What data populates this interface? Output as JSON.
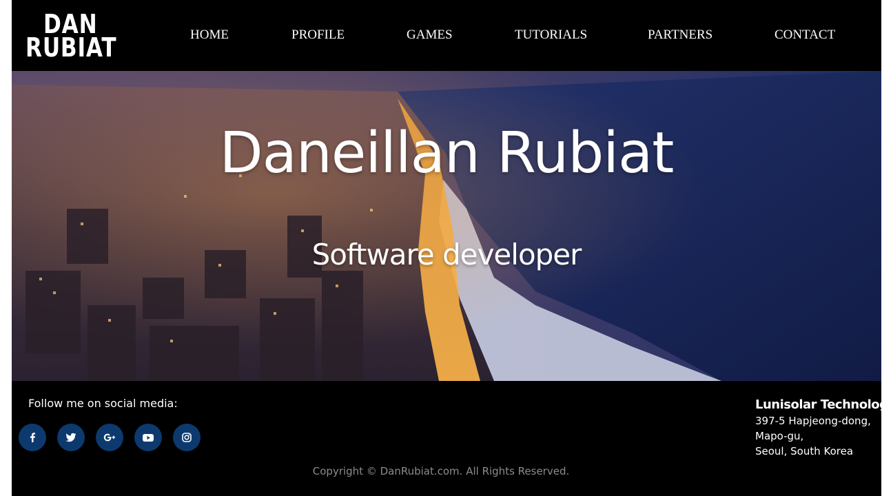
{
  "header": {
    "logo": {
      "line1": "DAN",
      "line2": "RUBIAT"
    },
    "nav": [
      {
        "label": "HOME"
      },
      {
        "label": "PROFILE"
      },
      {
        "label": "GAMES"
      },
      {
        "label": "TUTORIALS"
      },
      {
        "label": "PARTNERS"
      },
      {
        "label": "CONTACT"
      }
    ]
  },
  "hero": {
    "title": "Daneillan Rubiat",
    "subtitle": "Software developer"
  },
  "footer": {
    "follow_label": "Follow me on social media:",
    "social": [
      {
        "icon": "facebook-icon"
      },
      {
        "icon": "twitter-icon"
      },
      {
        "icon": "google-plus-icon"
      },
      {
        "icon": "youtube-icon"
      },
      {
        "icon": "instagram-icon"
      }
    ],
    "social_color": "#0d3a6e",
    "company": {
      "name": "Lunisolar Technology",
      "address": [
        "397-5 Hapjeong-dong,",
        "Mapo-gu,",
        "Seoul, South Korea"
      ]
    },
    "copyright": "Copyright © DanRubiat.com. All Rights Reserved."
  }
}
